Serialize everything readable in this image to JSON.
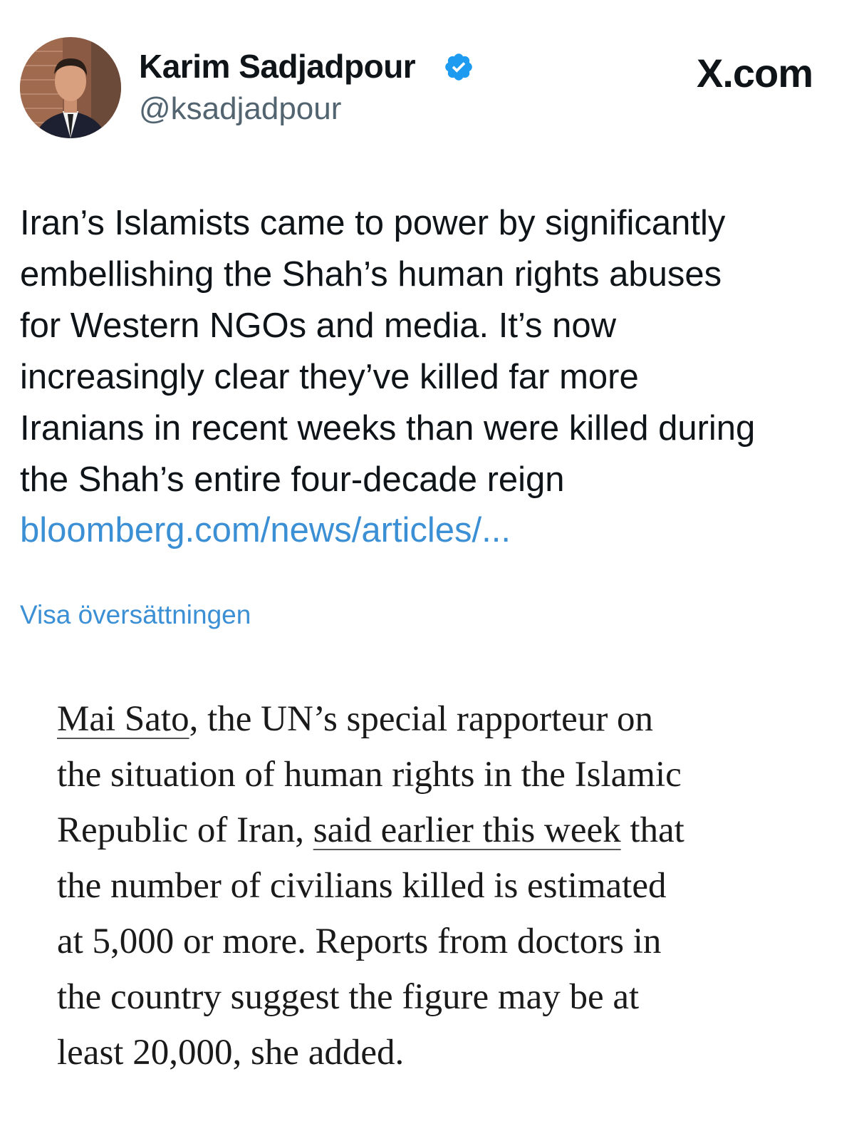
{
  "header": {
    "display_name": "Karim Sadjadpour",
    "handle": "@ksadjadpour",
    "site": "X.com",
    "verified_color": "#1d9bf0"
  },
  "tweet": {
    "lines": [
      "Iran’s Islamists came to power by significantly",
      "embellishing the Shah’s human rights abuses",
      "for Western NGOs and media. It’s now",
      "increasingly clear they’ve killed far more",
      "Iranians in recent weeks than were killed during",
      "the Shah’s entire four-decade reign"
    ],
    "link_text": "bloomberg.com/news/articles/...",
    "translate_label": "Visa översättningen",
    "link_color": "#3b8fd4"
  },
  "quote": {
    "line1_link": "Mai Sato",
    "line1_rest": ", the UN’s special rapporteur on",
    "line2": "the situation of human rights in the Islamic",
    "line3_pre": "Republic of Iran, ",
    "line3_link": "said earlier this week",
    "line3_post": " that",
    "line4": "the number of civilians killed is estimated",
    "line5": "at 5,000 or more. Reports from doctors in",
    "line6": "the country suggest the figure may be at",
    "line7": "least 20,000, she added."
  }
}
